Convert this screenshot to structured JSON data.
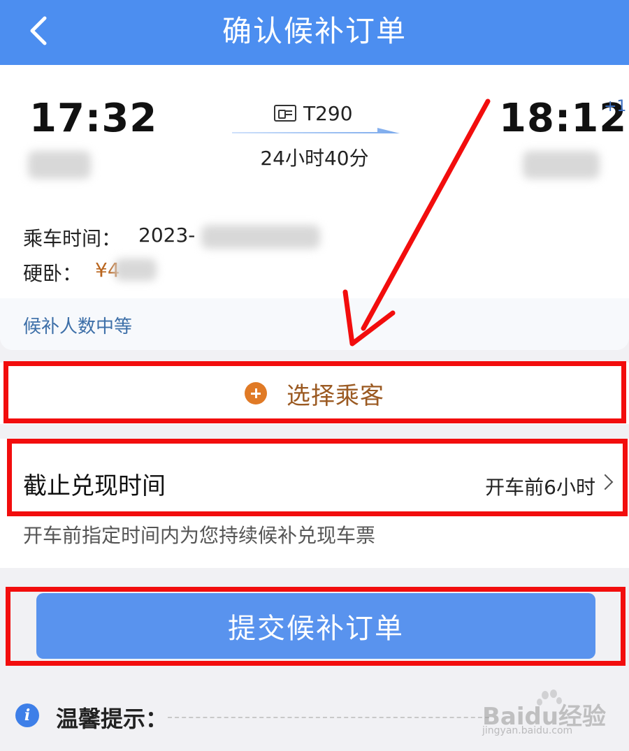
{
  "header": {
    "title": "确认候补订单"
  },
  "trip": {
    "departure_time": "17:32",
    "arrival_time": "18:12",
    "arrival_day_offset": "+1",
    "train_number": "T290",
    "duration": "24小时40分"
  },
  "details": {
    "ride_date_label": "乘车时间：",
    "ride_date_value": "2023-",
    "seat_label": "硬卧：",
    "price_prefix": "¥4",
    "demand_text": "候补人数中等"
  },
  "passenger": {
    "choose_label": "选择乘客"
  },
  "deadline": {
    "label": "截止兑现时间",
    "value": "开车前6小时",
    "description": "开车前指定时间内为您持续候补兑现车票"
  },
  "submit": {
    "label": "提交候补订单"
  },
  "tips": {
    "label": "温馨提示："
  },
  "watermark": {
    "text": "Baidu经验",
    "sub": "jingyan.baidu.com"
  },
  "colors": {
    "header_bg": "#4c8ef0",
    "submit_bg": "#5993ee",
    "price": "#b9651e",
    "accent_orange": "#e07a26",
    "annotation_red": "#f20d0d"
  }
}
